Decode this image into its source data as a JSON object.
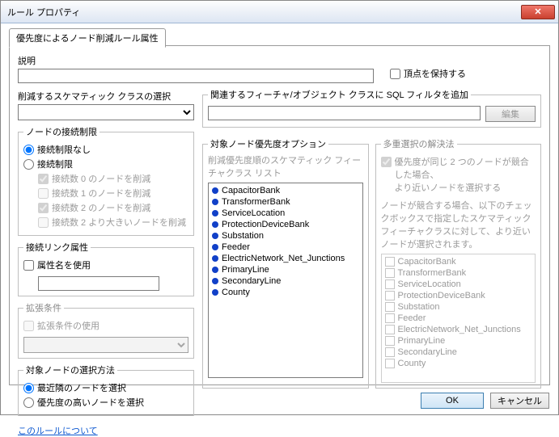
{
  "window": {
    "title": "ルール プロパティ"
  },
  "tab": {
    "label": "優先度によるノード削減ルール属性"
  },
  "desc": {
    "label": "説明",
    "value": ""
  },
  "keep_vertices": {
    "label": "頂点を保持する"
  },
  "schematic_select": {
    "label": "削減するスケマティック クラスの選択"
  },
  "filter": {
    "legend": "関連するフィーチャ/オブジェクト クラスに SQL フィルタを追加",
    "value": "",
    "edit_btn": "編集"
  },
  "conn_limit": {
    "legend": "ノードの接続制限",
    "none": "接続制限なし",
    "limit": "接続制限",
    "c0": "接続数 0 のノードを削減",
    "c1": "接続数 1 のノードを削減",
    "c2": "接続数 2 のノードを削減",
    "cmore": "接続数 2 より大きいノードを削減"
  },
  "link_attr": {
    "legend": "接続リンク属性",
    "use_attr": "属性名を使用",
    "value": ""
  },
  "ext_cond": {
    "legend": "拡張条件",
    "use": "拡張条件の使用"
  },
  "target_sel": {
    "legend": "対象ノードの選択方法",
    "nearest": "最近隣のノードを選択",
    "priority": "優先度の高いノードを選択"
  },
  "priority_opts": {
    "legend": "対象ノード優先度オプション",
    "sub": "削減優先度順のスケマティック フィーチャクラス リスト",
    "items": [
      "CapacitorBank",
      "TransformerBank",
      "ServiceLocation",
      "ProtectionDeviceBank",
      "Substation",
      "Feeder",
      "ElectricNetwork_Net_Junctions",
      "PrimaryLine",
      "SecondaryLine",
      "County"
    ]
  },
  "multi_sel": {
    "legend": "多重選択の解決法",
    "opt1a": "優先度が同じ 2 つのノードが競合した場合、",
    "opt1b": "より近いノードを選択する",
    "note1": "ノードが競合する場合、以下のチェックボックスで指定したスケマティック フィーチャクラスに対して、より近いノードが選択されます。",
    "items": [
      "CapacitorBank",
      "TransformerBank",
      "ServiceLocation",
      "ProtectionDeviceBank",
      "Substation",
      "Feeder",
      "ElectricNetwork_Net_Junctions",
      "PrimaryLine",
      "SecondaryLine",
      "County"
    ]
  },
  "about_link": "このルールについて",
  "footer": {
    "ok": "OK",
    "cancel": "キャンセル"
  }
}
